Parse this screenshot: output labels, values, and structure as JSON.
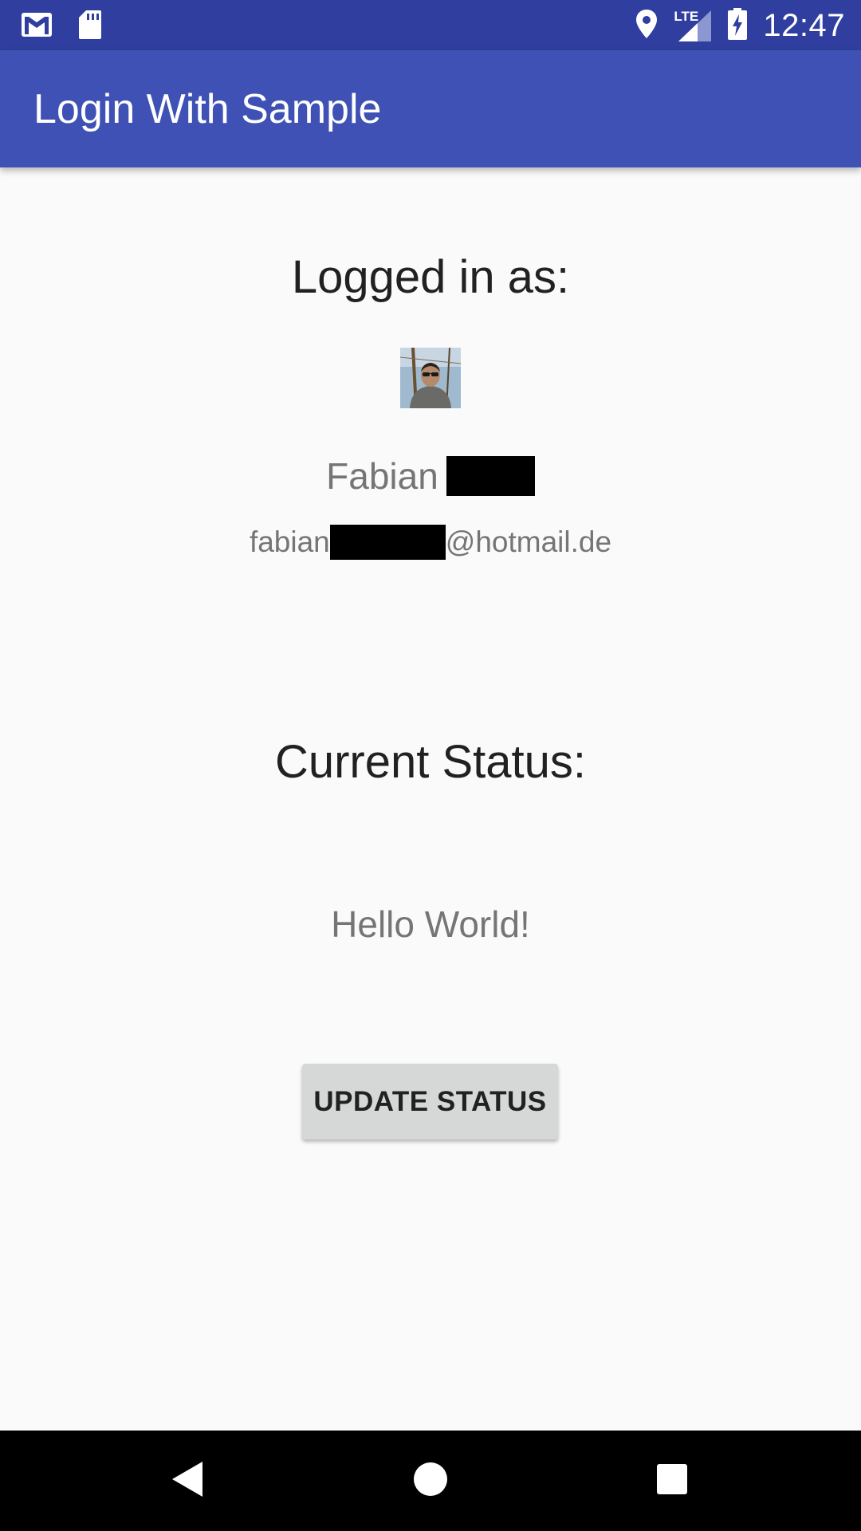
{
  "status_bar": {
    "time": "12:47",
    "network_label": "LTE",
    "left_icons": [
      "gmail-icon",
      "sd-card-icon"
    ],
    "right_icons": [
      "location-icon",
      "lte-signal-icon",
      "battery-charging-icon"
    ],
    "background": "#303f9f"
  },
  "app_bar": {
    "title": "Login With Sample",
    "background": "#3f51b5"
  },
  "profile": {
    "heading": "Logged in as:",
    "first_name": "Fabian",
    "email_prefix": "fabian",
    "email_domain": "@hotmail.de"
  },
  "status": {
    "heading": "Current Status:",
    "value": "Hello World!",
    "update_button_label": "UPDATE STATUS"
  },
  "nav_bar": {
    "buttons": [
      "back-icon",
      "home-icon",
      "recents-icon"
    ]
  }
}
